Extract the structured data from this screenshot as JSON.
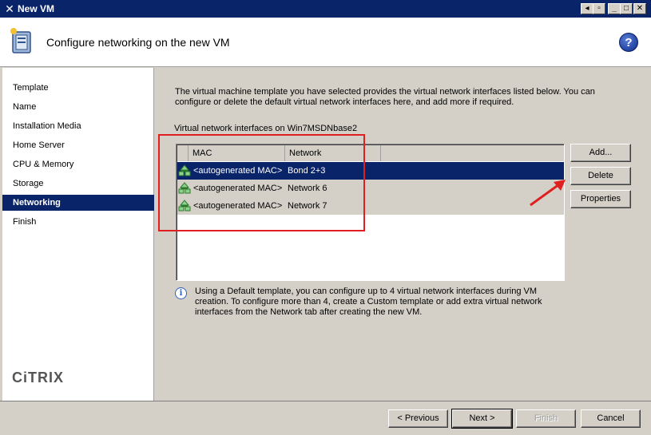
{
  "window": {
    "title": "New VM"
  },
  "header": {
    "title": "Configure networking on the new VM",
    "help": "?"
  },
  "nav": {
    "items": [
      "Template",
      "Name",
      "Installation Media",
      "Home Server",
      "CPU & Memory",
      "Storage",
      "Networking",
      "Finish"
    ],
    "active_index": 6
  },
  "brand": {
    "logo_text": "CiTRIX"
  },
  "main": {
    "intro": "The virtual machine template you have selected provides the virtual network interfaces listed below. You can configure or delete the default virtual network interfaces here, and add more if required.",
    "list_label": "Virtual network interfaces on Win7MSDNbase2",
    "columns": [
      "MAC",
      "Network"
    ],
    "rows": [
      {
        "mac": "<autogenerated MAC>",
        "network": "Bond 2+3",
        "selected": true
      },
      {
        "mac": "<autogenerated MAC>",
        "network": "Network 6",
        "selected": false
      },
      {
        "mac": "<autogenerated MAC>",
        "network": "Network 7",
        "selected": false
      }
    ],
    "buttons": {
      "add": "Add...",
      "delete": "Delete",
      "properties": "Properties"
    },
    "info": "Using a Default template, you can configure up to 4 virtual network interfaces during VM creation. To configure more than 4, create a Custom template or add extra virtual network interfaces from the Network tab after creating the new VM."
  },
  "footer": {
    "previous": "< Previous",
    "next": "Next >",
    "finish": "Finish",
    "cancel": "Cancel"
  },
  "colors": {
    "selection": "#0a246a",
    "annotation": "#e02020"
  }
}
